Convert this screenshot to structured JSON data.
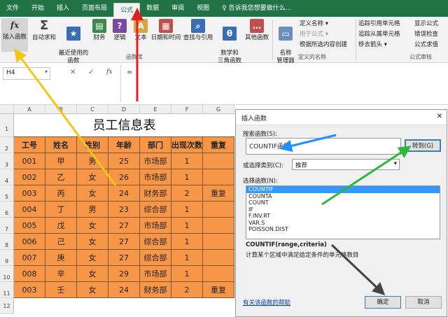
{
  "tabs": [
    "文件",
    "开始",
    "插入",
    "页面布局",
    "公式",
    "数据",
    "审阅",
    "视图",
    "♀ 告诉我您想要做什么..."
  ],
  "ribbon": {
    "insert_function": "插入函数",
    "autosum": "自动求和",
    "recent": "最近使用的\n函数",
    "financial": "财务",
    "logical": "逻辑",
    "text": "文本",
    "datetime": "日期和时间",
    "lookup": "查找与引用",
    "math": "数学和\n三角函数",
    "other": "其他函数",
    "library_group": "函数库",
    "name_manager": "名称\n管理器",
    "define_name": "定义名称 ▾",
    "use_in_formula": "用于公式 ▾",
    "create_from_sel": "根据所选内容创建",
    "names_group": "定义的名称",
    "trace_prec": "追踪引用单元格",
    "trace_dep": "追踪从属单元格",
    "remove_arrows": "移去箭头 ▾",
    "show_formulas": "显示公式",
    "error_check": "错误检查",
    "eval": "公式求值",
    "audit_group": "公式审核"
  },
  "formula_bar": {
    "name_box": "H4",
    "fx": "fx",
    "content": "="
  },
  "sheet": {
    "columns": [
      "A",
      "B",
      "C",
      "D",
      "E",
      "F",
      "G"
    ],
    "rows": [
      "1",
      "2",
      "3",
      "4",
      "5",
      "6",
      "7",
      "8",
      "9",
      "10",
      "11",
      "12"
    ],
    "title": "员工信息表",
    "headers": [
      "工号",
      "姓名",
      "性别",
      "年龄",
      "部门",
      "出现次数",
      "重复"
    ],
    "data": [
      [
        "001",
        "甲",
        "男",
        "25",
        "市场部",
        "1",
        ""
      ],
      [
        "002",
        "乙",
        "女",
        "26",
        "市场部",
        "1",
        ""
      ],
      [
        "003",
        "丙",
        "女",
        "24",
        "财务部",
        "2",
        "重复"
      ],
      [
        "004",
        "丁",
        "男",
        "23",
        "综合部",
        "1",
        ""
      ],
      [
        "005",
        "戊",
        "女",
        "27",
        "市场部",
        "1",
        ""
      ],
      [
        "006",
        "己",
        "女",
        "27",
        "综合部",
        "1",
        ""
      ],
      [
        "007",
        "庚",
        "女",
        "27",
        "综合部",
        "1",
        ""
      ],
      [
        "008",
        "辛",
        "女",
        "29",
        "市场部",
        "1",
        ""
      ],
      [
        "003",
        "壬",
        "女",
        "24",
        "财务部",
        "2",
        "重复"
      ]
    ]
  },
  "dialog": {
    "title": "插入函数",
    "search_label": "搜索函数(S):",
    "search_value": "COUNTIF函数",
    "go": "转到(G)",
    "category_label": "或选择类别(C):",
    "category": "推荐",
    "select_label": "选择函数(N):",
    "functions": [
      "COUNTIF",
      "COUNTA",
      "COUNT",
      "IF",
      "F.INV.RT",
      "VAR.S",
      "POISSON.DIST"
    ],
    "signature": "COUNTIF(range,criteria)",
    "description": "计算某个区域中满足给定条件的单元格数目",
    "help": "有关该函数的帮助",
    "ok": "确定",
    "cancel": "取消"
  }
}
